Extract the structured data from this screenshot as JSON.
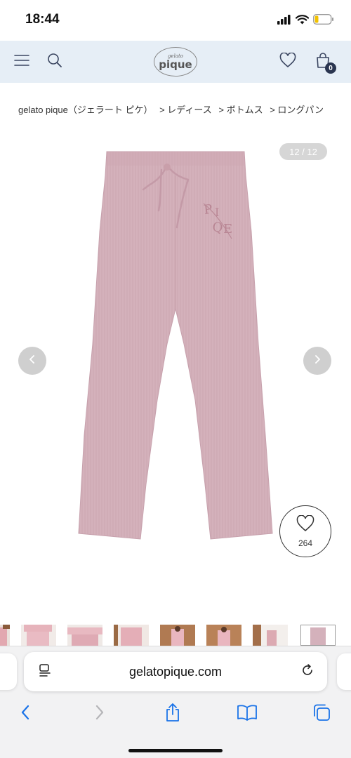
{
  "status_bar": {
    "time": "18:44"
  },
  "header": {
    "logo_small": "gelato",
    "logo_main": "pique",
    "cart_count": "0"
  },
  "breadcrumb": {
    "items": [
      "gelato pique（ジェラート ピケ）",
      "> レディース",
      "> ボトムス",
      "> ロングパン"
    ]
  },
  "gallery": {
    "counter": "12 / 12",
    "favorite_count": "264",
    "product_color": "#d4b1bb"
  },
  "thumbnails": {
    "count": 9,
    "active_index": 8
  },
  "browser": {
    "url": "gelatopique.com"
  },
  "icons": {
    "menu": "menu-icon",
    "search": "search-icon",
    "heart": "heart-icon",
    "cart": "shopping-bag-icon",
    "prev": "chevron-left-icon",
    "next": "chevron-right-icon",
    "reader": "reader-icon",
    "reload": "reload-icon",
    "back": "back-arrow-icon",
    "forward": "forward-arrow-icon",
    "share": "share-icon",
    "bookmarks": "book-icon",
    "tabs": "tabs-icon"
  }
}
